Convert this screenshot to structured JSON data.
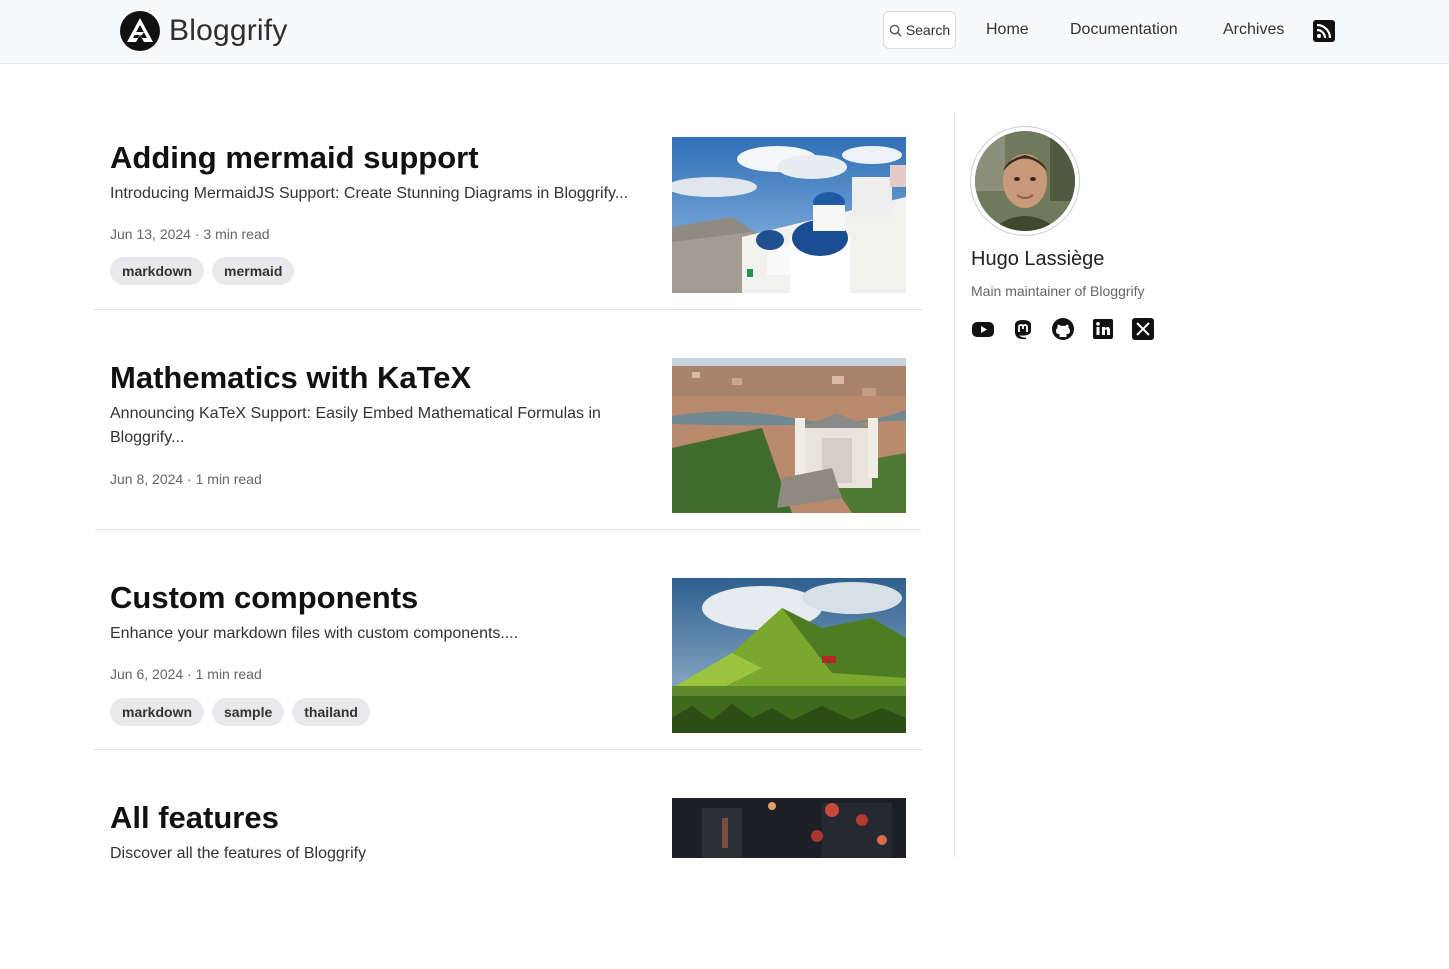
{
  "site": {
    "name": "Bloggrify",
    "logo_icon": "triangle-logo-icon",
    "search_label": "Search",
    "search_icon": "search-icon",
    "nav": [
      {
        "label": "Home"
      },
      {
        "label": "Documentation"
      },
      {
        "label": "Archives"
      }
    ],
    "rss_icon": "rss-icon"
  },
  "posts": [
    {
      "title": "Adding mermaid support",
      "description": "Introducing MermaidJS Support: Create Stunning Diagrams in Bloggrify...",
      "meta": "Jun 13, 2024 · 3 min read",
      "tags": [
        "markdown",
        "mermaid"
      ],
      "image": "santorini-blue-domes-photo"
    },
    {
      "title": "Mathematics with KaTeX",
      "description": "Announcing KaTeX Support: Easily Embed Mathematical Formulas in Bloggrify...",
      "meta": "Jun 8, 2024 · 1 min read",
      "tags": [],
      "image": "lyon-basilica-aerial-photo"
    },
    {
      "title": "Custom components",
      "description": "Enhance your markdown files with custom components....",
      "meta": "Jun 6, 2024 · 1 min read",
      "tags": [
        "markdown",
        "sample",
        "thailand"
      ],
      "image": "green-mountain-landscape-photo"
    },
    {
      "title": "All features",
      "description": "Discover all the features of Bloggrify",
      "meta": "",
      "tags": [],
      "image": "night-lanterns-photo"
    }
  ],
  "author": {
    "name": "Hugo Lassiège",
    "bio": "Main maintainer of Bloggrify",
    "avatar": "author-avatar-photo",
    "socials": [
      "youtube-icon",
      "mastodon-icon",
      "github-icon",
      "linkedin-icon",
      "x-icon"
    ]
  }
}
